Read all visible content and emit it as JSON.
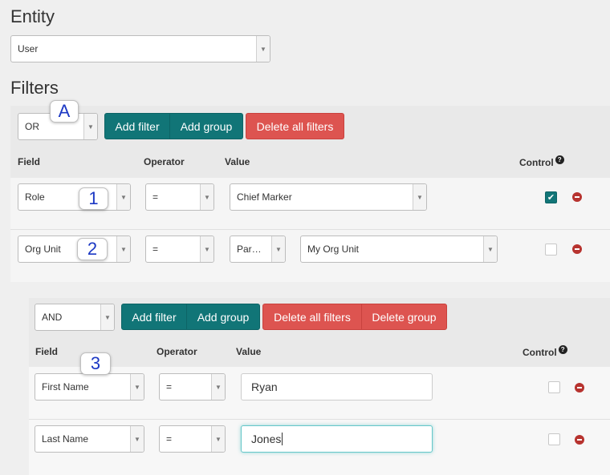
{
  "entity": {
    "heading": "Entity",
    "selected": "User"
  },
  "filters": {
    "heading": "Filters",
    "outer": {
      "condition": "OR",
      "buttons": {
        "add_filter": "Add filter",
        "add_group": "Add group",
        "delete_all": "Delete all filters"
      },
      "columns": {
        "field": "Field",
        "operator": "Operator",
        "value": "Value",
        "control": "Control"
      },
      "rules": [
        {
          "field": "Role",
          "operator": "=",
          "value": "Chief Marker",
          "control_checked": true
        },
        {
          "field": "Org Unit",
          "operator": "=",
          "value_mode": "Par…",
          "value": "My Org Unit",
          "control_checked": false
        }
      ]
    },
    "inner": {
      "condition": "AND",
      "buttons": {
        "add_filter": "Add filter",
        "add_group": "Add group",
        "delete_all": "Delete all filters",
        "delete_group": "Delete group"
      },
      "columns": {
        "field": "Field",
        "operator": "Operator",
        "value": "Value",
        "control": "Control"
      },
      "rules": [
        {
          "field": "First Name",
          "operator": "=",
          "value": "Ryan",
          "control_checked": false
        },
        {
          "field": "Last Name",
          "operator": "=",
          "value": "Jones",
          "control_checked": false
        }
      ]
    }
  },
  "callouts": [
    "A",
    "1",
    "2",
    "3"
  ],
  "icons": {
    "dropdown": "chevron-down-icon",
    "help": "question-circle-icon",
    "remove": "minus-circle-icon",
    "check": "checkmark-icon"
  },
  "colors": {
    "teal": "#117577",
    "red": "#dd5450",
    "remove": "#b7332f",
    "callout_text": "#1c38c4"
  }
}
